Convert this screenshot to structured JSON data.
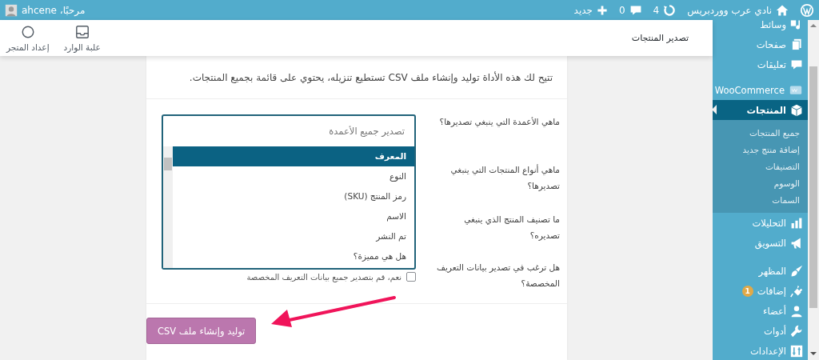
{
  "admin_bar": {
    "site_name": "نادي عرب ووردبريس",
    "updates": "4",
    "comments": "0",
    "new_label": "جديد",
    "greeting": "مرحبًا، ahcene"
  },
  "sidebar": {
    "groups": [
      [
        {
          "label": "وسائط",
          "selected": false
        },
        {
          "label": "صفحات",
          "selected": false
        },
        {
          "label": "تعليقات",
          "selected": false
        }
      ],
      [
        {
          "label": "WooCommerce",
          "selected": false
        },
        {
          "label": "المنتجات",
          "selected": true,
          "children": [
            {
              "label": "جميع المنتجات",
              "selected": false
            },
            {
              "label": "إضافة منتج جديد",
              "selected": false
            },
            {
              "label": "التصنيفات",
              "selected": false
            },
            {
              "label": "الوسوم",
              "selected": false
            },
            {
              "label": "السمات",
              "selected": false
            }
          ]
        },
        {
          "label": "التحليلات",
          "selected": false
        },
        {
          "label": "التسويق",
          "selected": false
        }
      ],
      [
        {
          "label": "المظهر",
          "selected": false
        },
        {
          "label": "إضافات",
          "selected": false,
          "badge": "1"
        },
        {
          "label": "أعضاء",
          "selected": false
        },
        {
          "label": "أدوات",
          "selected": false
        },
        {
          "label": "الإعدادات",
          "selected": false
        }
      ]
    ]
  },
  "header": {
    "title": "تصدير المنتجات",
    "actions": [
      {
        "label": "علبة الوارد"
      },
      {
        "label": "إعداد المتجر"
      }
    ]
  },
  "exporter": {
    "description": "تتيح لك هذه الأداة توليد وإنشاء ملف CSV تستطيع تنزيله، يحتوي على قائمة بجميع المنتجات.",
    "fields": [
      {
        "label": "ماهي الأعمدة التي ينبغي تصديرها؟"
      },
      {
        "label": "ماهي أنواع المنتجات التي ينبغي تصديرها؟"
      },
      {
        "label": "ما تصنيف المنتج الذي ينبغي تصديره؟"
      },
      {
        "label": "هل ترغب في تصدير بيانات التعريف المخصصة؟",
        "checkbox": {
          "label": "نعم، قم بتصدير جميع بيانات التعريف المخصصة",
          "checked": false
        }
      }
    ],
    "dropdown": {
      "placeholder": "تصدير جميع الأعمدة",
      "options": [
        {
          "label": "المعرف",
          "selected": true
        },
        {
          "label": "النوع",
          "selected": false
        },
        {
          "label": "رمز المنتج (SKU)",
          "selected": false
        },
        {
          "label": "الاسم",
          "selected": false
        },
        {
          "label": "تم النشر",
          "selected": false
        },
        {
          "label": "هل هي مميزة؟",
          "selected": false
        }
      ]
    },
    "button": "توليد وإنشاء ملف CSV"
  }
}
